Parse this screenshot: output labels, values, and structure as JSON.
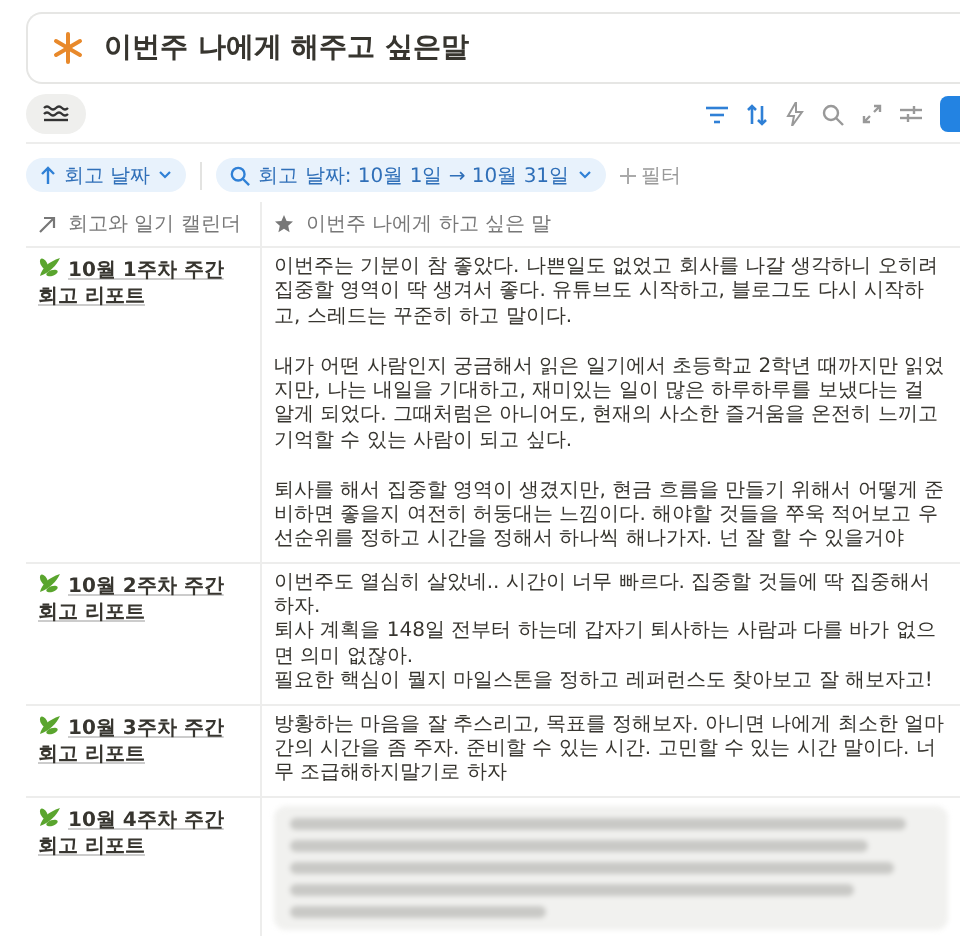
{
  "callout": {
    "title": "이번주 나에게 해주고 싶은말"
  },
  "filters": {
    "sort": "회고 날짜",
    "date_filter": "회고 날짜: 10월 1일 → 10월 31일",
    "add_filter": "필터"
  },
  "table": {
    "columns": [
      "회고와 일기 캘린더",
      "이번주 나에게 하고 싶은 말"
    ],
    "rows": [
      {
        "title": "10월 1주차 주간 회고 리포트",
        "message": "이번주는 기분이 참 좋았다. 나쁜일도 없었고 회사를 나갈 생각하니 오히려 집중할 영역이 딱 생겨서 좋다. 유튜브도 시작하고, 블로그도 다시 시작하고, 스레드는 꾸준히 하고 말이다.\n\n내가 어떤 사람인지 궁금해서 읽은 일기에서 초등학교 2학년 때까지만 읽었지만, 나는 내일을 기대하고, 재미있는 일이 많은 하루하루를 보냈다는 걸 알게 되었다. 그때처럼은 아니어도, 현재의 사소한 즐거움을 온전히 느끼고 기억할 수 있는 사람이 되고 싶다.\n\n퇴사를 해서 집중할 영역이 생겼지만, 현금 흐름을 만들기 위해서 어떻게 준비하면 좋을지 여전히 허둥대는 느낌이다. 해야할 것들을 쭈욱 적어보고 우선순위를 정하고 시간을 정해서 하나씩 해나가자. 넌 잘 할 수 있을거야",
        "blurred": false
      },
      {
        "title": "10월 2주차 주간 회고 리포트",
        "message": "이번주도 열심히 살았네.. 시간이 너무 빠르다. 집중할 것들에 딱 집중해서 하자.\n퇴사 계획을 148일 전부터 하는데 갑자기 퇴사하는 사람과 다를 바가 없으면 의미 없잖아.\n필요한 핵심이 뭘지 마일스톤을 정하고 레퍼런스도 찾아보고 잘 해보자고!",
        "blurred": false
      },
      {
        "title": "10월 3주차 주간 회고 리포트",
        "message": "방황하는 마음을 잘 추스리고, 목표를 정해보자. 아니면 나에게 최소한 얼마간의 시간을 좀 주자. 준비할 수 있는 시간. 고민할 수 있는 시간 말이다. 너무 조급해하지말기로 하자",
        "blurred": false
      },
      {
        "title": "10월 4주차 주간 회고 리포트",
        "blurred": true
      }
    ]
  }
}
